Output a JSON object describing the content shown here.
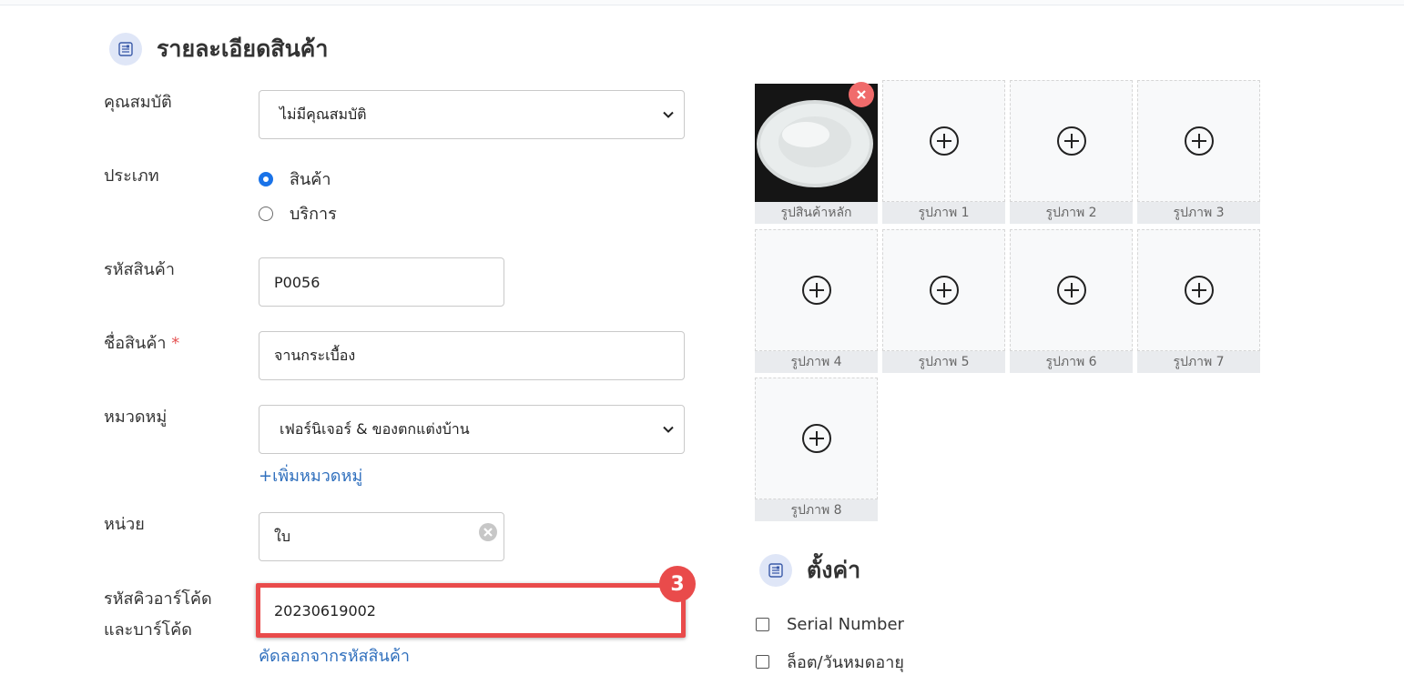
{
  "product_details": {
    "title": "รายละเอียดสินค้า",
    "attribute": {
      "label": "คุณสมบัติ",
      "value": "ไม่มีคุณสมบัติ"
    },
    "type": {
      "label": "ประเภท",
      "options": [
        {
          "label": "สินค้า",
          "selected": true
        },
        {
          "label": "บริการ",
          "selected": false
        }
      ]
    },
    "product_code": {
      "label": "รหัสสินค้า",
      "value": "P0056"
    },
    "product_name": {
      "label": "ชื่อสินค้า",
      "required_mark": "*",
      "value": "จานกระเบื้อง"
    },
    "category": {
      "label": "หมวดหมู่",
      "value": "เฟอร์นิเจอร์ & ของตกแต่งบ้าน",
      "add_link": "+เพิ่มหมวดหมู่"
    },
    "unit": {
      "label": "หน่วย",
      "value": "ใบ"
    },
    "barcode": {
      "label_line1": "รหัสคิวอาร์โค้ด",
      "label_line2": "และบาร์โค้ด",
      "value": "20230619002",
      "copy_link": "คัดลอกจากรหัสสินค้า"
    }
  },
  "annotation": {
    "step_number": "3",
    "color": "#e94b4b"
  },
  "images": {
    "main_caption": "รูปสินค้าหลัก",
    "slots": [
      "รูปภาพ 1",
      "รูปภาพ 2",
      "รูปภาพ 3",
      "รูปภาพ 4",
      "รูปภาพ 5",
      "รูปภาพ 6",
      "รูปภาพ 7",
      "รูปภาพ 8"
    ]
  },
  "settings": {
    "title": "ตั้งค่า",
    "options": [
      {
        "label": "Serial Number",
        "checked": false
      },
      {
        "label": "ล็อต/วันหมดอายุ",
        "checked": false
      }
    ]
  },
  "colors": {
    "link": "#2f6fbd",
    "accent": "#1a73e8",
    "required": "#e55353",
    "icon_bg": "#dfe6f7"
  }
}
